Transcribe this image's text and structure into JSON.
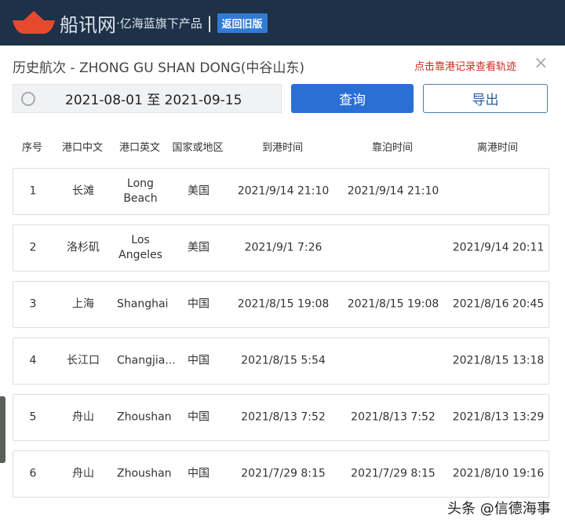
{
  "header": {
    "brand": "船讯网",
    "subtitle": "·亿海蓝旗下产品",
    "separator": "|",
    "old_version_button": "返回旧版"
  },
  "page": {
    "title": "历史航次 - ZHONG GU SHAN DONG(中谷山东)",
    "hint": "点击靠港记录查看轨迹",
    "close_icon": "×"
  },
  "filter": {
    "date_range": "2021-08-01 至 2021-09-15",
    "query_button": "查询",
    "export_button": "导出"
  },
  "table": {
    "columns": [
      "序号",
      "港口中文",
      "港口英文",
      "国家或地区",
      "到港时间",
      "靠泊时间",
      "离港时间"
    ],
    "rows": [
      [
        "1",
        "长滩",
        "Long Beach",
        "美国",
        "2021/9/14 21:10",
        "2021/9/14 21:10",
        ""
      ],
      [
        "2",
        "洛杉矶",
        "Los Angeles",
        "美国",
        "2021/9/1 7:26",
        "",
        "2021/9/14 20:11"
      ],
      [
        "3",
        "上海",
        "Shanghai",
        "中国",
        "2021/8/15 19:08",
        "2021/8/15 19:08",
        "2021/8/16 20:45"
      ],
      [
        "4",
        "长江口",
        "Changjia...",
        "中国",
        "2021/8/15 5:54",
        "",
        "2021/8/15 13:18"
      ],
      [
        "5",
        "舟山",
        "Zhoushan",
        "中国",
        "2021/8/13 7:52",
        "2021/8/13 7:52",
        "2021/8/13 13:29"
      ],
      [
        "6",
        "舟山",
        "Zhoushan",
        "中国",
        "2021/7/29 8:15",
        "2021/7/29 8:15",
        "2021/8/10 19:16"
      ]
    ]
  },
  "watermark": "头条 @信德海事"
}
